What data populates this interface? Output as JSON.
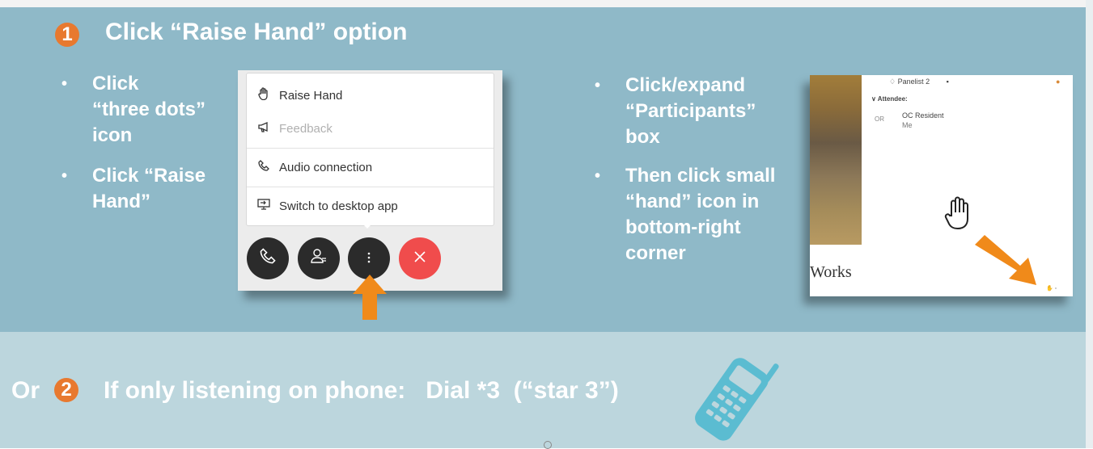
{
  "step1": {
    "number": "1",
    "heading": "Click “Raise Hand” option",
    "left_bullets": [
      {
        "line1": "Click",
        "line2": "“three dots”",
        "line3": "icon"
      },
      {
        "line1": "Click “Raise",
        "line2": "Hand”"
      }
    ],
    "menu": {
      "items": [
        {
          "label": "Raise Hand",
          "icon": "hand-icon"
        },
        {
          "label": "Feedback",
          "icon": "megaphone-icon",
          "disabled": true
        },
        {
          "label": "Audio connection",
          "icon": "phone-icon"
        },
        {
          "label": "Switch to desktop app",
          "icon": "desktop-icon"
        }
      ],
      "controls": [
        {
          "name": "phone-control",
          "icon": "phone-icon"
        },
        {
          "name": "participants-control",
          "icon": "person-icon"
        },
        {
          "name": "more-control",
          "icon": "three-dots-icon"
        },
        {
          "name": "end-control",
          "icon": "close-icon"
        }
      ]
    },
    "right_bullets": [
      {
        "line1": "Click/expand",
        "line2": "“Participants”",
        "line3": "box"
      },
      {
        "line1": "Then click small",
        "line2": "“hand” icon in",
        "line3": "bottom-right",
        "line4": "corner"
      }
    ],
    "participants": {
      "panelist": "Panelist 2",
      "attendee_header": "Attendee:",
      "initials": "OR",
      "attendee_name": "OC Resident",
      "attendee_sub": "Me",
      "works_text": "Works"
    }
  },
  "step2": {
    "prefix": "Or",
    "number": "2",
    "text": "If only listening on phone:   Dial *3  (“star 3”)"
  },
  "colors": {
    "top_panel": "#8fb9c8",
    "bottom_panel": "#bcd6dd",
    "accent_orange": "#e8792f",
    "end_call_red": "#f04c4c",
    "phone_blue": "#5bbcd1"
  }
}
